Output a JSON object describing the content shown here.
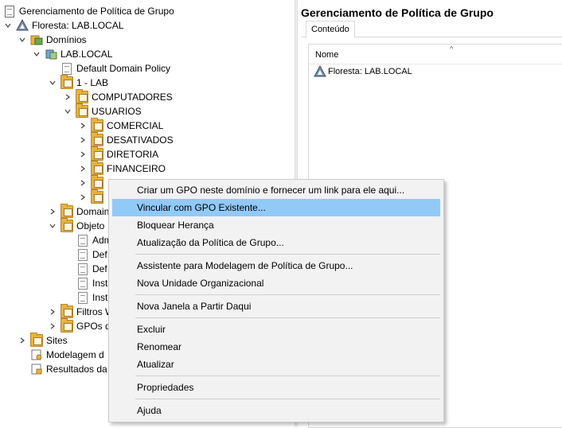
{
  "tree": {
    "root": "Gerenciamento de Política de Grupo",
    "forest": "Floresta: LAB.LOCAL",
    "domains": "Domínios",
    "domain": "LAB.LOCAL",
    "default_policy": "Default Domain Policy",
    "ou_lab": "1 - LAB",
    "ou_computadores": "COMPUTADORES",
    "ou_usuarios": "USUARIOS",
    "ou_comercial": "COMERCIAL",
    "ou_desativados": "DESATIVADOS",
    "ou_diretoria": "DIRETORIA",
    "ou_financeiro": "FINANCEIRO",
    "domain_controllers": "Domain",
    "gpo_objects": "Objeto",
    "gpo_adm": "Adm",
    "gpo_def1": "Def",
    "gpo_def2": "Def",
    "gpo_inst1": "Inst",
    "gpo_inst2": "Inst",
    "wmi_filters": "Filtros W",
    "starter_gpos": "GPOs d",
    "sites": "Sites",
    "modeling": "Modelagem d",
    "results": "Resultados da"
  },
  "right": {
    "title": "Gerenciamento de Política de Grupo",
    "tab": "Conteúdo",
    "column": "Nome",
    "row": "Floresta: LAB.LOCAL"
  },
  "menu": {
    "items": [
      "Criar um GPO neste domínio e fornecer um link para ele aqui...",
      "Vincular com GPO Existente...",
      "Bloquear Herança",
      "Atualização da Política de Grupo...",
      "Assistente para Modelagem de Política de Grupo...",
      "Nova Unidade Organizacional",
      "Nova Janela a Partir Daqui",
      "Excluir",
      "Renomear",
      "Atualizar",
      "Propriedades",
      "Ajuda"
    ],
    "highlighted_index": 1,
    "highlight_color": "#91c9f7"
  },
  "colors": {
    "folder": "#e8b33c",
    "selection": "#91c9f7"
  },
  "icons": {
    "expanded": "chevron-down-icon",
    "collapsed": "chevron-right-icon"
  }
}
